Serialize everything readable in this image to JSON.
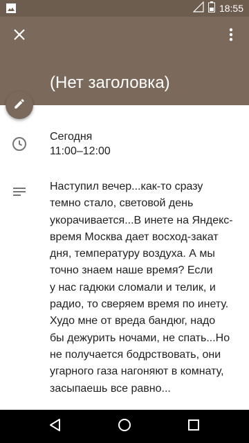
{
  "status_bar": {
    "time": "18:55",
    "left_icon": "image-icon",
    "right_icons": [
      "signal-icon",
      "battery-icon"
    ]
  },
  "header": {
    "close_icon": "close-icon",
    "more_icon": "more-vert-icon",
    "title": "(Нет заголовка)"
  },
  "edit_button": {
    "icon": "pencil-icon"
  },
  "event_time": {
    "icon": "clock-icon",
    "date": "Сегодня",
    "range": "11:00–12:00"
  },
  "description": {
    "icon": "notes-icon",
    "lines": [
      "Наступил вечер...как-то сразу",
      "темно стало, световой день",
      "укорачивается...В инете на Яндекс-",
      "время Москва дает восход-закат",
      "дня, температуру воздуха. А мы",
      "точно знаем наше время? Если",
      "у нас гадюки сломали и телик, и",
      "радио, то сверяем время по инету.",
      "Худо мне от вреда бандюг, надо",
      "бы дежурить ночами, не спать...Но",
      "не получается бодрствовать, они",
      "угарного газа нагоняют в комнату,",
      "засыпаешь все равно..."
    ]
  },
  "nav_bar": {
    "back_icon": "back-triangle-icon",
    "home_icon": "home-circle-icon",
    "recent_icon": "recent-square-icon"
  },
  "colors": {
    "header": "#7b6a5b",
    "status_bar": "#6d5d4f",
    "nav_bar": "#000000",
    "icon_gray": "#757575"
  }
}
